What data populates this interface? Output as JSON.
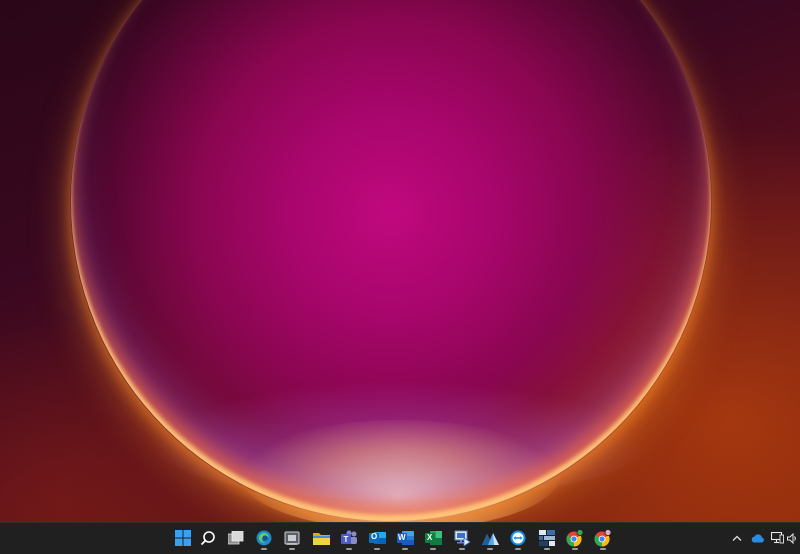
{
  "desktop": {
    "wallpaper": "windows-11-bloom"
  },
  "taskbar": {
    "background": "#202020",
    "items": [
      {
        "name": "start-button",
        "icon": "windows-logo-icon",
        "color": "#3aa0f0",
        "running": false
      },
      {
        "name": "search-button",
        "icon": "search-icon",
        "color": "#ffffff",
        "running": false
      },
      {
        "name": "task-view-button",
        "icon": "task-view-icon",
        "color": "#cccccc",
        "running": false
      },
      {
        "name": "edge-button",
        "icon": "edge-icon",
        "color": "#2fa8d8",
        "running": true
      },
      {
        "name": "app-button-5",
        "icon": "hardware-app-icon",
        "color": "#9aa0a6",
        "running": true
      },
      {
        "name": "file-explorer-button",
        "icon": "folder-icon",
        "color": "#f4c430",
        "running": false
      },
      {
        "name": "teams-button",
        "icon": "teams-icon",
        "color": "#6264a7",
        "running": true
      },
      {
        "name": "outlook-button",
        "icon": "outlook-icon",
        "color": "#0f6cbd",
        "running": true
      },
      {
        "name": "word-button",
        "icon": "word-icon",
        "color": "#2b579a",
        "running": true
      },
      {
        "name": "excel-button",
        "icon": "excel-icon",
        "color": "#217346",
        "running": true
      },
      {
        "name": "remote-desktop-button",
        "icon": "remote-desktop-icon",
        "color": "#3c6fd1",
        "running": true
      },
      {
        "name": "app-button-12",
        "icon": "mountain-app-icon",
        "color": "#1f7ac4",
        "running": true
      },
      {
        "name": "teamviewer-button",
        "icon": "teamviewer-icon",
        "color": "#0e8ee9",
        "running": true
      },
      {
        "name": "app-button-14",
        "icon": "grid-app-icon",
        "color": "#3a6ea5",
        "running": true
      },
      {
        "name": "chrome-button",
        "icon": "chrome-icon",
        "color": "#e84335",
        "running": true
      },
      {
        "name": "chrome-profile-button",
        "icon": "chrome-profile-icon",
        "color": "#e84335",
        "running": true
      }
    ],
    "tray": [
      {
        "name": "show-hidden-icons",
        "icon": "chevron-up-icon"
      },
      {
        "name": "onedrive",
        "icon": "cloud-icon",
        "color": "#2a8be0"
      },
      {
        "name": "network",
        "icon": "network-icon"
      },
      {
        "name": "volume",
        "icon": "speaker-icon"
      }
    ],
    "glyphs": {
      "outlook": "O",
      "word": "W",
      "excel": "X",
      "chevron": "^"
    }
  }
}
